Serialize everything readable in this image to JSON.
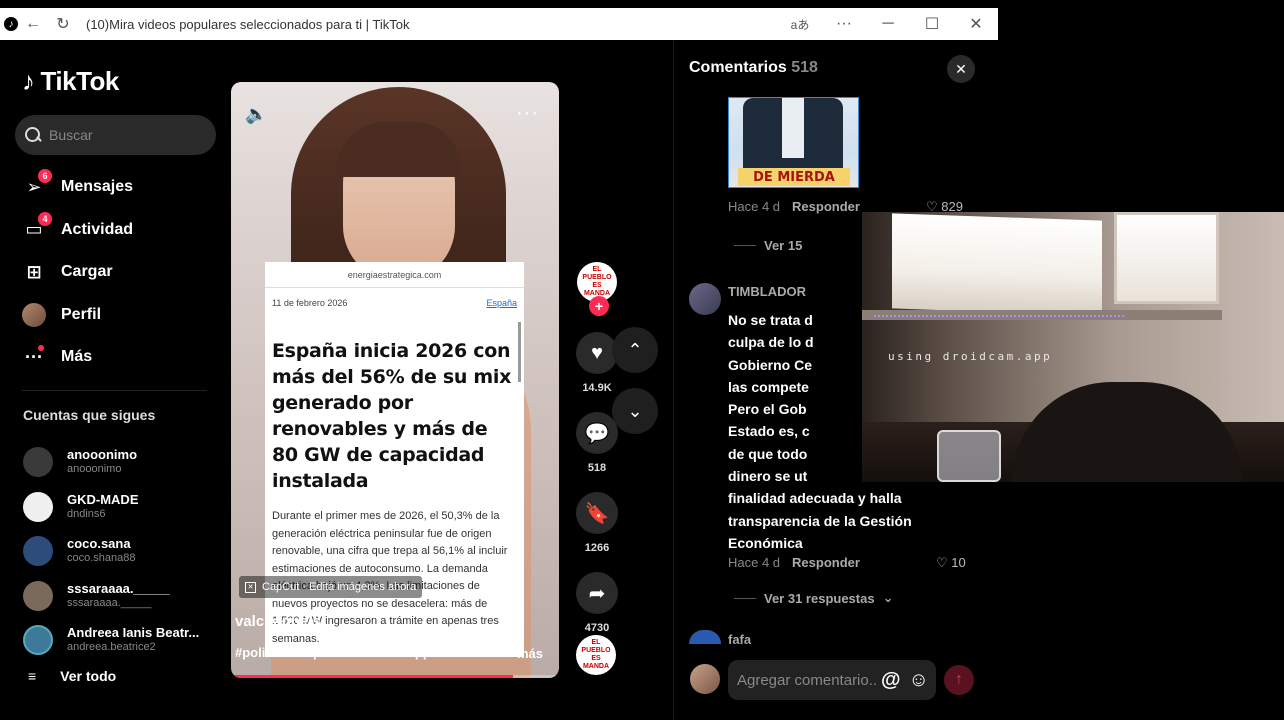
{
  "browser": {
    "tab_title": "(10)Mira videos populares seleccionados para ti | TikTok",
    "back_icon": "←",
    "reload_icon": "↻",
    "translate_icon": "aあ",
    "menu_icon": "···",
    "minimize_icon": "─",
    "maximize_icon": "☐",
    "close_icon": "✕"
  },
  "sidebar": {
    "logo_text": "TikTok",
    "search_placeholder": "Buscar",
    "nav": [
      {
        "label": "Mensajes",
        "icon": "⊳",
        "badge": "6"
      },
      {
        "label": "Actividad",
        "icon": "▭",
        "badge": "4"
      },
      {
        "label": "Cargar",
        "icon": "⊞",
        "badge": ""
      },
      {
        "label": "Perfil",
        "icon": "",
        "badge": ""
      },
      {
        "label": "Más",
        "icon": "···",
        "badge": ""
      }
    ],
    "following_title": "Cuentas que sigues",
    "following": [
      {
        "name": "anooonimo",
        "handle": "anooonimo",
        "color": "#3a3a3a"
      },
      {
        "name": "GKD-MADE",
        "handle": "dndins6",
        "color": "#f0f0f0"
      },
      {
        "name": "coco.sana",
        "handle": "coco.shana88",
        "color": "#2e4c7a"
      },
      {
        "name": "sssaraaaa._____",
        "handle": "sssaraaaa._____",
        "color": "#7a6a5a"
      },
      {
        "name": "Andreea Ianis Beatr...",
        "handle": "andreea.beatrice2",
        "color": "#3d7a9a"
      }
    ],
    "see_all": "Ver todo",
    "see_all_icon": "≡"
  },
  "video": {
    "volume_icon": "🔈",
    "more_icon": "···",
    "article": {
      "source": "energiaestrategica.com",
      "date": "11 de febrero 2026",
      "category": "España",
      "headline": "España inicia 2026 con más del 56% de su mix generado por renovables y más de 80 GW de capacidad instalada",
      "body": "Durante el primer mes de 2026, el 50,3% de la generación eléctrica peninsular fue de origen renovable, una cifra que trepa al 56,1% al incluir estimaciones de autoconsumo. La demanda eléctrica bajó un 4,3%. Las limitaciones de nuevos proyectos no se desacelera: más de 1.500 MW ingresaron a trámite en apenas tres semanas."
    },
    "capcut": "CapCut · Edita imágenes ahora",
    "author": "valchannels",
    "tags": "#politica #españa #derecha #pp ...",
    "more": "más",
    "progress": 0.86
  },
  "actions": {
    "likes": "14.9K",
    "comments": "518",
    "saves": "1266",
    "shares": "4730",
    "channel_badge": "EL PUEBLO ES MANDA"
  },
  "comments": {
    "title": "Comentarios",
    "count": "518",
    "close_icon": "✕",
    "image_caption": "DE MIERDA",
    "c1": {
      "time": "Hace 4 d",
      "reply": "Responder",
      "likes": "829",
      "view": "Ver 15"
    },
    "c2": {
      "user": "TIMBLADOR",
      "text_lines": [
        "No se trata d",
        "culpa de lo d",
        "Gobierno Ce",
        "las compete",
        "Pero el Gob",
        "Estado es, c",
        "de que todo",
        "dinero se ut",
        "finalidad adecuada y halla",
        "transparencia de la Gestión",
        "Económica"
      ],
      "time": "Hace 4 d",
      "reply": "Responder",
      "likes": "10",
      "view": "Ver 31 respuestas"
    },
    "c3": {
      "user": "fafa"
    },
    "input_placeholder": "Agregar comentario...",
    "at_icon": "@",
    "emoji_icon": "☺",
    "send_icon": "↑"
  },
  "webcam": {
    "watermark": "using droidcam.app"
  }
}
